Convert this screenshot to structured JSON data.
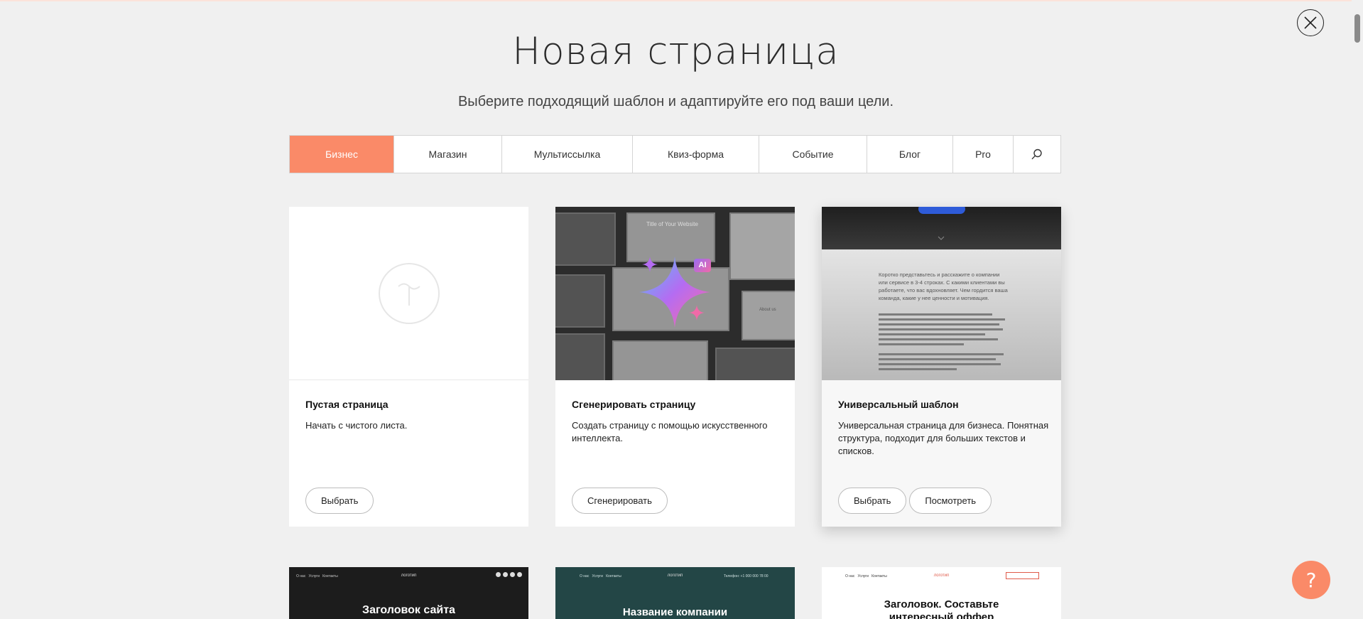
{
  "page": {
    "title": "Новая страница",
    "subtitle": "Выберите подходящий шаблон и адаптируйте его под ваши цели."
  },
  "tabs": [
    {
      "label": "Бизнес",
      "active": true
    },
    {
      "label": "Магазин"
    },
    {
      "label": "Мультиссылка"
    },
    {
      "label": "Квиз-форма"
    },
    {
      "label": "Событие"
    },
    {
      "label": "Блог"
    },
    {
      "label": "Pro"
    }
  ],
  "search": {
    "icon": "search-icon"
  },
  "cards": [
    {
      "name": "Пустая страница",
      "description": "Начать с чистого листа.",
      "select_label": "Выбрать"
    },
    {
      "name": "Сгенерировать страницу",
      "description": "Создать страницу с помощью искусственного интеллекта.",
      "generate_label": "Сгенерировать",
      "preview_title": "Title of Your Website",
      "ai_badge": "AI",
      "preview_about": "About us"
    },
    {
      "name": "Универсальный шаблон",
      "description": "Универсальная страница для бизнеса. Понятная структура, подходит для больших текстов и списков.",
      "select_label": "Выбрать",
      "view_label": "Посмотреть",
      "preview_text": "Коротко представьтесь и расскажите о компании или сервисе в 3-4 строках. С какими клиентами вы работаете, что вас вдохновляет. Чем гордится ваша команда, какие у нее ценности и мотивация."
    }
  ],
  "bottom_cards": [
    {
      "heading": "Заголовок сайта",
      "logo": "логотип",
      "nav": [
        "О нас",
        "Услуги",
        "Контакты"
      ]
    },
    {
      "heading": "Название компании",
      "logo": "логотип",
      "nav": [
        "О нас",
        "Услуги",
        "Контакты"
      ],
      "phone": "Телефон: +1 000 000 78 00"
    },
    {
      "heading": "Заголовок. Составьте интересный оффер",
      "logo": "логотип",
      "nav": [
        "О нас",
        "Услуги",
        "Контакты"
      ]
    }
  ],
  "help": {
    "label": "?"
  },
  "colors": {
    "accent": "#fa8a68",
    "background": "#f0f0f0"
  }
}
